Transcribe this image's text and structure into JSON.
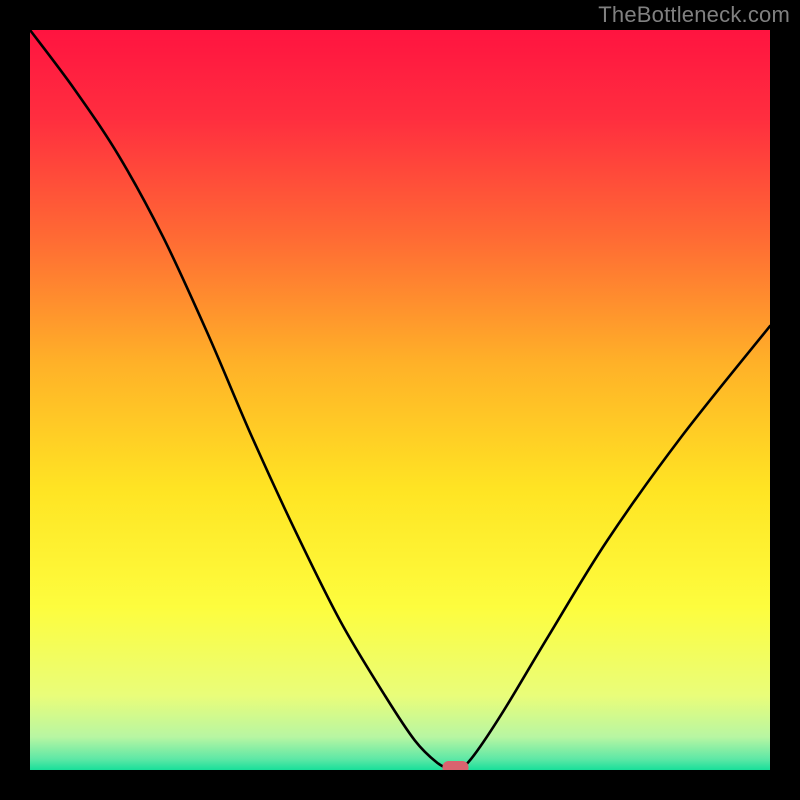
{
  "watermark": "TheBottleneck.com",
  "chart_data": {
    "type": "line",
    "title": "",
    "xlabel": "",
    "ylabel": "",
    "xlim": [
      0,
      100
    ],
    "ylim": [
      0,
      100
    ],
    "series": [
      {
        "name": "bottleneck-curve",
        "x": [
          0,
          6,
          12,
          18,
          24,
          30,
          36,
          42,
          48,
          52,
          55,
          57,
          58,
          60,
          64,
          70,
          78,
          88,
          100
        ],
        "values": [
          100,
          92,
          83,
          72,
          59,
          45,
          32,
          20,
          10,
          4,
          1,
          0,
          0,
          2,
          8,
          18,
          31,
          45,
          60
        ]
      }
    ],
    "marker": {
      "x": 57.5,
      "y": 0
    },
    "gradient_stops": [
      {
        "offset": 0.0,
        "color": "#ff1440"
      },
      {
        "offset": 0.12,
        "color": "#ff2e3f"
      },
      {
        "offset": 0.28,
        "color": "#ff6a34"
      },
      {
        "offset": 0.45,
        "color": "#ffb128"
      },
      {
        "offset": 0.62,
        "color": "#ffe423"
      },
      {
        "offset": 0.78,
        "color": "#fdfd3e"
      },
      {
        "offset": 0.9,
        "color": "#e9fd7a"
      },
      {
        "offset": 0.955,
        "color": "#b8f6a2"
      },
      {
        "offset": 0.985,
        "color": "#5fe8a6"
      },
      {
        "offset": 1.0,
        "color": "#18df9a"
      }
    ]
  }
}
